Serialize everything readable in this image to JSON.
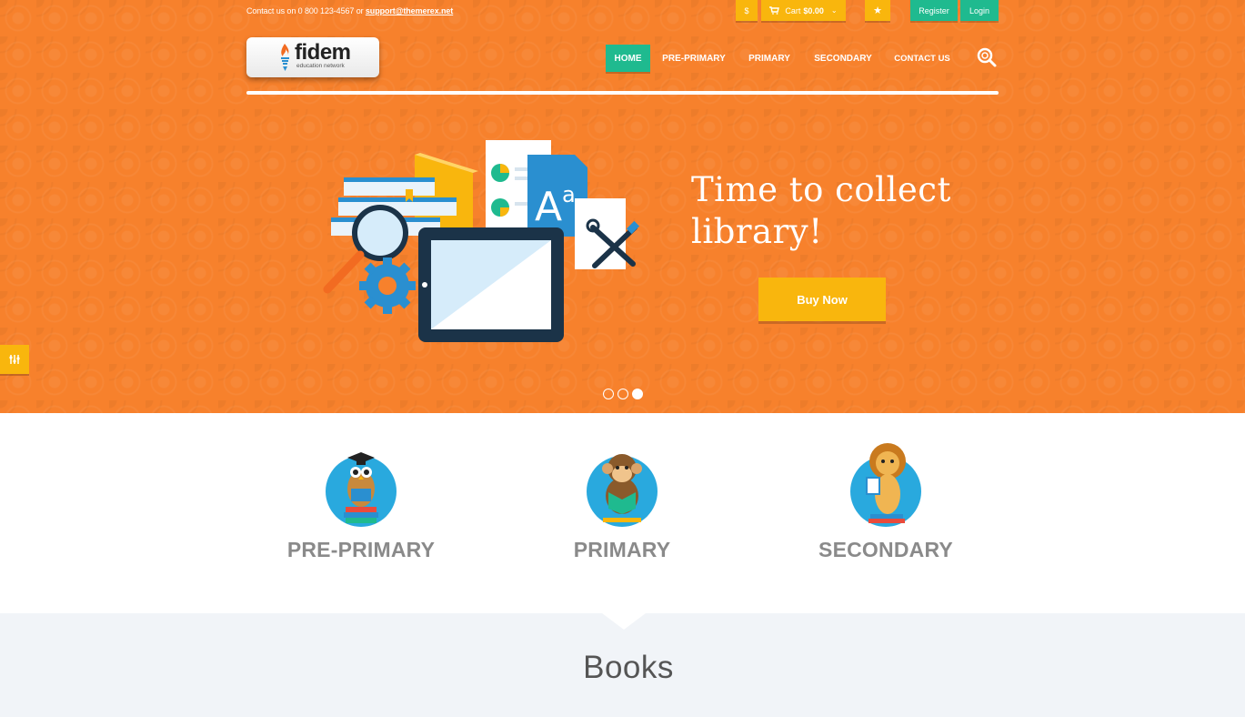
{
  "topbar": {
    "contact_prefix": "Contact us on 0 800 123-4567 or",
    "contact_email": "support@themerex.net",
    "currency_label": "$",
    "cart_label": "Cart",
    "cart_total": "$0.00",
    "register_label": "Register",
    "login_label": "Login"
  },
  "logo": {
    "name": "fidem",
    "tagline": "education network"
  },
  "nav": {
    "items": [
      "HOME",
      "PRE-PRIMARY",
      "PRIMARY",
      "SECONDARY",
      "CONTACT US"
    ]
  },
  "slider": {
    "title_line1": "Time to collect",
    "title_line2": "library!",
    "button_label": "Buy Now",
    "slide_count": 3,
    "active_slide": 3
  },
  "categories": [
    {
      "label": "PRE-PRIMARY",
      "icon": "owl-graduate-icon"
    },
    {
      "label": "PRIMARY",
      "icon": "monkey-reading-icon"
    },
    {
      "label": "SECONDARY",
      "icon": "lion-reading-icon"
    }
  ],
  "books_section": {
    "title": "Books"
  },
  "colors": {
    "hero_orange": "#f7812c",
    "accent_yellow": "#f9b60d",
    "accent_green": "#1fba8f",
    "circle_blue": "#29a9de",
    "band_gray": "#f1f4f8"
  }
}
